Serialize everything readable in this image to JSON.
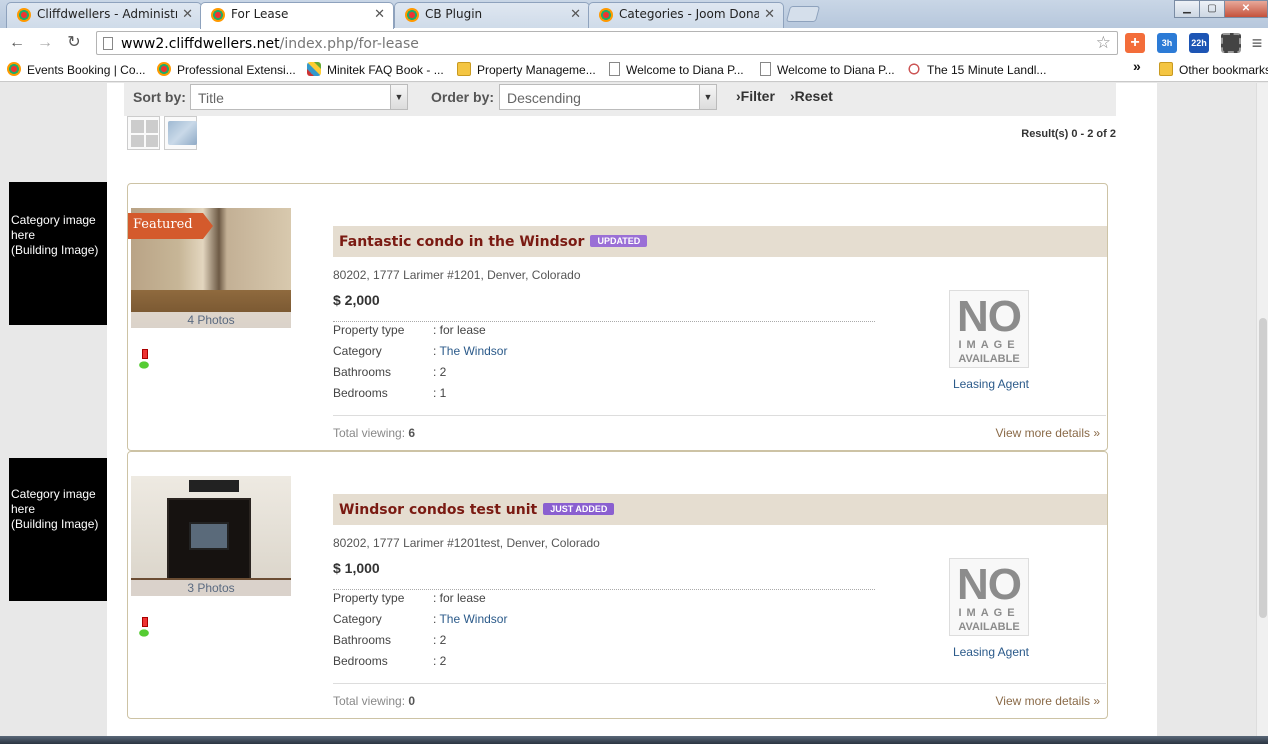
{
  "browser": {
    "tabs": [
      {
        "title": "Cliffdwellers - Administrat"
      },
      {
        "title": "For Lease"
      },
      {
        "title": "CB Plugin"
      },
      {
        "title": "Categories - Joom Donati"
      }
    ],
    "url_host": "www2.cliffdwellers.net",
    "url_path": "/index.php/for-lease",
    "extensions": [
      "3h",
      "22h"
    ],
    "bookmarks": [
      {
        "label": "Events Booking | Co...",
        "icon": "joomla-icon"
      },
      {
        "label": "Professional Extensi...",
        "icon": "joomla-icon"
      },
      {
        "label": "Minitek FAQ Book - ...",
        "icon": "minitek-icon"
      },
      {
        "label": "Property Manageme...",
        "icon": "folder-icon"
      },
      {
        "label": "Welcome to Diana P...",
        "icon": "page-icon"
      },
      {
        "label": "Welcome to Diana P...",
        "icon": "page-icon"
      },
      {
        "label": "The 15 Minute Landl...",
        "icon": "clock-icon"
      }
    ],
    "overflow": "»",
    "other_bookmarks": "Other bookmarks"
  },
  "filters": {
    "sort_label": "Sort by:",
    "sort_value": "Title",
    "order_label": "Order by:",
    "order_value": "Descending",
    "filter_btn": "›Filter",
    "reset_btn": "›Reset"
  },
  "results_text": "Result(s) 0 - 2 of 2",
  "category_image_text_1": "Category image here",
  "category_image_text_2": "(Building Image)",
  "listings": [
    {
      "featured": "Featured",
      "photos": "4 Photos",
      "title": "Fantastic condo in the Windsor",
      "badge": "UPDATED",
      "address": "80202, 1777 Larimer #1201, Denver, Colorado",
      "price": "$ 2,000",
      "properties": [
        {
          "key": "Property type",
          "value": ": for lease"
        },
        {
          "key": "Category",
          "value": ": ",
          "link": "The Windsor"
        },
        {
          "key": "Bathrooms",
          "value": ": 2"
        },
        {
          "key": "Bedrooms",
          "value": ": 1"
        }
      ],
      "noimage": {
        "big": "NO",
        "mid": "IMAGE",
        "small": "AVAILABLE"
      },
      "agent": "Leasing Agent",
      "viewing_label": "Total viewing:",
      "viewing_count": "6",
      "more": "View more details »"
    },
    {
      "featured": "",
      "photos": "3 Photos",
      "title": "Windsor condos test unit",
      "badge": "JUST ADDED",
      "address": "80202, 1777 Larimer #1201test, Denver, Colorado",
      "price": "$ 1,000",
      "properties": [
        {
          "key": "Property type",
          "value": ": for lease"
        },
        {
          "key": "Category",
          "value": ": ",
          "link": "The Windsor"
        },
        {
          "key": "Bathrooms",
          "value": ": 2"
        },
        {
          "key": "Bedrooms",
          "value": ": 2"
        }
      ],
      "noimage": {
        "big": "NO",
        "mid": "IMAGE",
        "small": "AVAILABLE"
      },
      "agent": "Leasing Agent",
      "viewing_label": "Total viewing:",
      "viewing_count": "0",
      "more": "View more details »"
    }
  ],
  "colors": {
    "badge_updated": "#9a6fd6",
    "badge_just_added": "#8a5fd0",
    "featured_ribbon": "#d45a2c",
    "title_text": "#7a1a12"
  }
}
